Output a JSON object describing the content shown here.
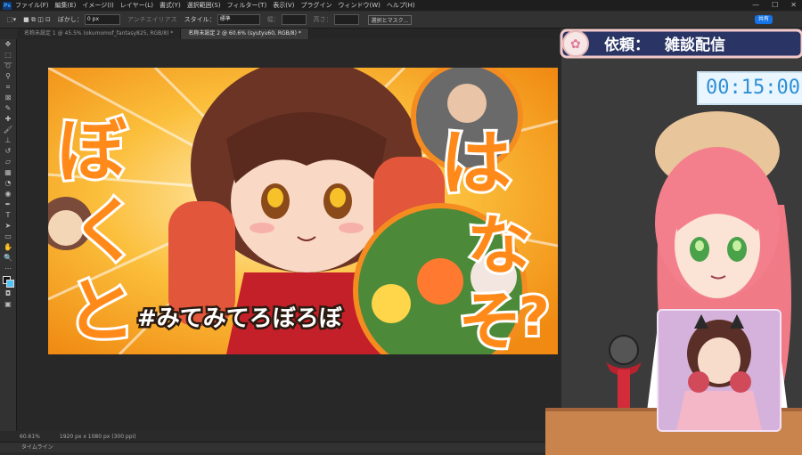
{
  "menubar": {
    "logo": "Ps",
    "items": [
      "ファイル(F)",
      "編集(E)",
      "イメージ(I)",
      "レイヤー(L)",
      "書式(Y)",
      "選択範囲(S)",
      "フィルター(T)",
      "表示(V)",
      "プラグイン",
      "ウィンドウ(W)",
      "ヘルプ(H)"
    ],
    "window_controls": [
      "—",
      "☐",
      "✕"
    ]
  },
  "options": {
    "blur_label": "ぼかし：",
    "blur_value": "0 px",
    "antialias_label": "アンチエイリアス",
    "style_label": "スタイル：",
    "style_value": "標準",
    "width_label": "幅：",
    "height_label": "高さ：",
    "select_mask": "選択とマスク...",
    "share": "共有"
  },
  "tabs": [
    {
      "label": "名称未設定 1 @ 45.5% (okumomof_fantasy825, RGB/8) *"
    },
    {
      "label": "名称未設定 2 @ 60.6% (syutyu60, RGB/8) *"
    }
  ],
  "thumbnail": {
    "left_text": [
      "ぼ",
      "く",
      "と"
    ],
    "right_text": [
      "は",
      "な",
      "そ",
      "?"
    ],
    "hashtag": "#みてみてろぼろぼ"
  },
  "status": {
    "zoom": "60.61%",
    "doc_info": "1920 px x 1080 px (300 ppi)"
  },
  "timeline": {
    "label": "タイムライン"
  },
  "overlay": {
    "banner_label": "依頼：",
    "banner_value": "雑談配信",
    "timer": "00:15:00"
  },
  "colors": {
    "accent_orange": "#f7931e",
    "banner_navy": "#2a3566",
    "timer_blue": "#2d8fd6"
  }
}
